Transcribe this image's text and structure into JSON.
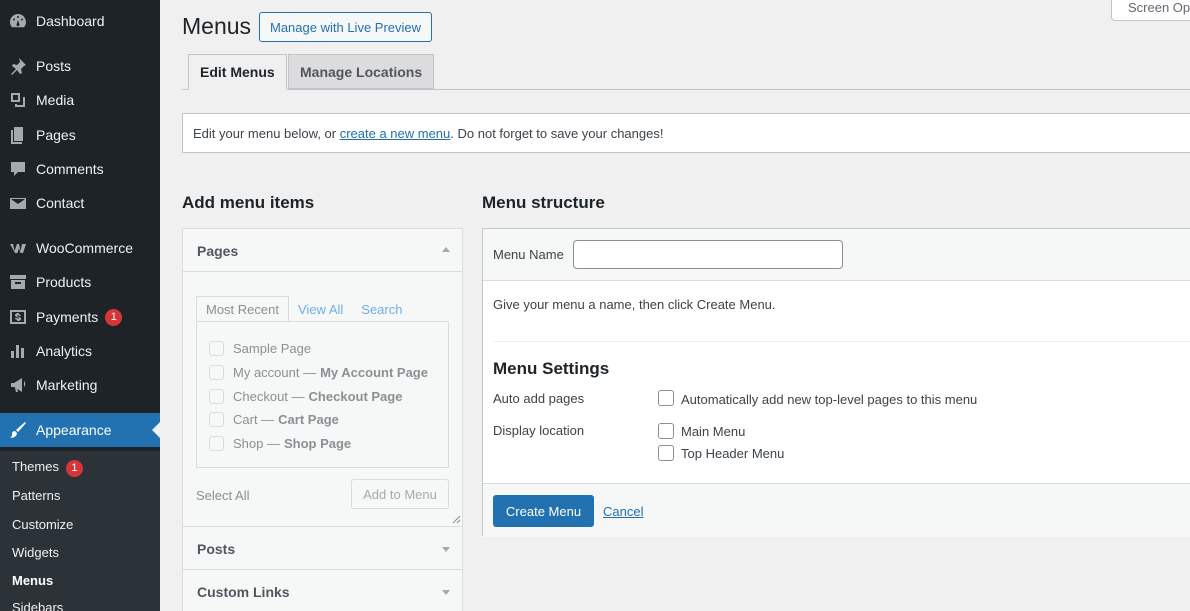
{
  "sidebar": {
    "items": [
      {
        "label": "Dashboard",
        "icon": "dashboard-icon"
      },
      {
        "label": "Posts",
        "icon": "pushpin-icon"
      },
      {
        "label": "Media",
        "icon": "media-icon"
      },
      {
        "label": "Pages",
        "icon": "pages-icon"
      },
      {
        "label": "Comments",
        "icon": "comment-icon"
      },
      {
        "label": "Contact",
        "icon": "envelope-icon"
      },
      {
        "label": "WooCommerce",
        "icon": "woo-icon"
      },
      {
        "label": "Products",
        "icon": "archive-icon"
      },
      {
        "label": "Payments",
        "icon": "dollar-icon",
        "badge": "1"
      },
      {
        "label": "Analytics",
        "icon": "bar-chart-icon"
      },
      {
        "label": "Marketing",
        "icon": "megaphone-icon"
      },
      {
        "label": "Appearance",
        "icon": "paintbrush-icon"
      }
    ],
    "submenu": [
      {
        "label": "Themes",
        "badge": "1"
      },
      {
        "label": "Patterns"
      },
      {
        "label": "Customize"
      },
      {
        "label": "Widgets"
      },
      {
        "label": "Menus"
      },
      {
        "label": "Sidebars"
      }
    ]
  },
  "header": {
    "title": "Menus",
    "live_preview_label": "Manage with Live Preview",
    "screen_options_label": "Screen Options"
  },
  "tabs": [
    {
      "label": "Edit Menus",
      "active": true
    },
    {
      "label": "Manage Locations",
      "active": false
    }
  ],
  "notice": {
    "before": "Edit your menu below, or ",
    "link": "create a new menu",
    "after": ". Do not forget to save your changes!"
  },
  "add_items": {
    "heading": "Add menu items",
    "pages_title": "Pages",
    "subtabs": [
      "Most Recent",
      "View All",
      "Search"
    ],
    "pages": [
      {
        "title": "Sample Page",
        "suffix": ""
      },
      {
        "title": "My account — ",
        "suffix": "My Account Page"
      },
      {
        "title": "Checkout — ",
        "suffix": "Checkout Page"
      },
      {
        "title": "Cart — ",
        "suffix": "Cart Page"
      },
      {
        "title": "Shop — ",
        "suffix": "Shop Page"
      }
    ],
    "select_all": "Select All",
    "add_button": "Add to Menu",
    "posts_title": "Posts",
    "custom_links_title": "Custom Links"
  },
  "structure": {
    "heading": "Menu structure",
    "menu_name_label": "Menu Name",
    "menu_name_value": "",
    "instructions": "Give your menu a name, then click Create Menu.",
    "settings_heading": "Menu Settings",
    "auto_add_label": "Auto add pages",
    "auto_add_option": "Automatically add new top-level pages to this menu",
    "display_location_label": "Display location",
    "locations": [
      "Main Menu",
      "Top Header Menu"
    ],
    "create_button": "Create Menu",
    "cancel_link": "Cancel"
  },
  "colors": {
    "accent": "#2271b1",
    "sidebar_bg": "#1d2327",
    "badge": "#d63638"
  }
}
